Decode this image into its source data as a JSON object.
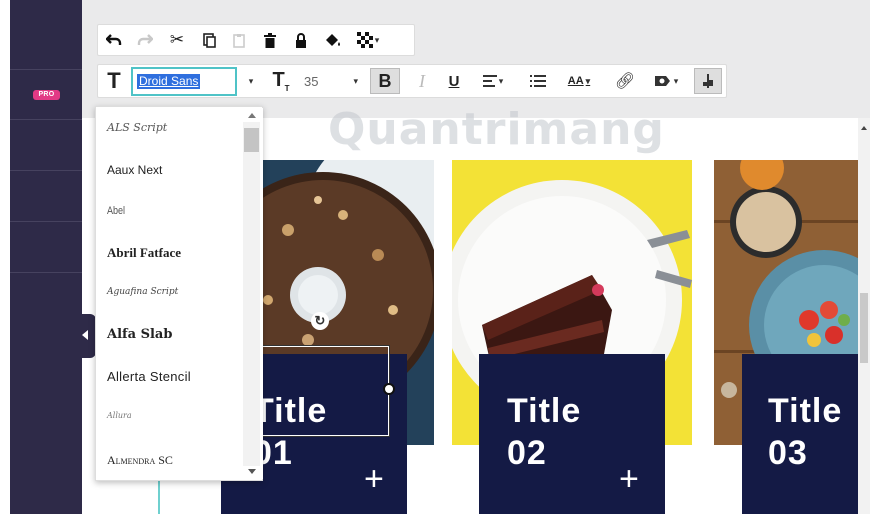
{
  "sidebar": {
    "badge": "PRO"
  },
  "toolbar_top": {
    "icons": [
      "undo-icon",
      "redo-icon",
      "cut-icon",
      "copy-icon",
      "paste-icon",
      "delete-icon",
      "lock-icon",
      "fill-icon",
      "transparency-icon"
    ]
  },
  "toolbar_text": {
    "font_value": "Droid Sans",
    "font_size": "35",
    "bold": "B",
    "italic": "I",
    "underline": "U",
    "text_size_label": "AA"
  },
  "font_list": {
    "items": [
      "ALS Script",
      "Aaux Next",
      "Abel",
      "Abril Fatface",
      "Aguafina Script",
      "Alfa Slab",
      "Allerta Stencil",
      "Allura",
      "Almendra SC"
    ]
  },
  "cards": [
    {
      "title": "Title\n01",
      "plus": "+"
    },
    {
      "title": "Title\n02",
      "plus": "+"
    },
    {
      "title": "Title\n03"
    }
  ],
  "watermark": "Quantrimang"
}
